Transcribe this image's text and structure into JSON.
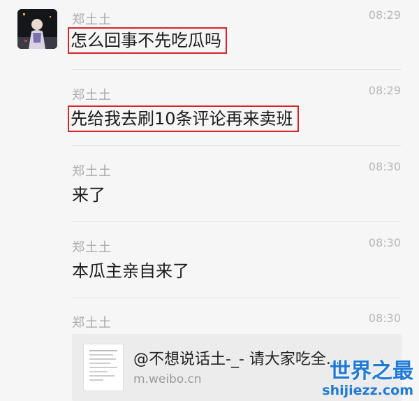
{
  "messages": [
    {
      "sender": "郑土土",
      "time": "08:29",
      "text": "怎么回事不先吃瓜吗"
    },
    {
      "sender": "郑土土",
      "time": "08:29",
      "text": "先给我去刷10条评论再来卖班"
    },
    {
      "sender": "郑土土",
      "time": "08:30",
      "text": "来了"
    },
    {
      "sender": "郑土土",
      "time": "08:30",
      "text": "本瓜主亲自来了"
    },
    {
      "sender": "郑土土",
      "time": "08:30"
    }
  ],
  "link_card": {
    "title": "@不想说话土-_-  请大家吃全...",
    "url": "m.weibo.cn"
  },
  "watermark": {
    "title": "世界之最",
    "domain": "shijiezz.com"
  },
  "colors": {
    "highlight_border": "#d8232a",
    "watermark": "#1f7ad6"
  }
}
